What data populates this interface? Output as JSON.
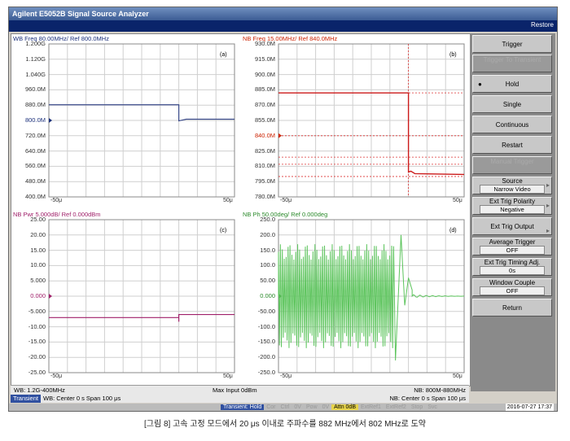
{
  "window": {
    "title": "Agilent E5052B Signal Source Analyzer",
    "restore_label": "Restore"
  },
  "panels": {
    "a": {
      "title": "WB Freq 80.00MHz/ Ref 800.0MHz",
      "badge": "(a)",
      "title_color": "#1a2f7a",
      "y_labels": [
        "1.200G",
        "1.120G",
        "1.040G",
        "960.0M",
        "880.0M",
        "800.0M",
        "720.0M",
        "640.0M",
        "560.0M",
        "480.0M",
        "400.0M"
      ],
      "x_left": "-50μ",
      "x_right": "50μ",
      "ref_label": "800.0M"
    },
    "b": {
      "title": "NB Freq 15.00MHz/ Ref 840.0MHz",
      "badge": "(b)",
      "title_color": "#cc2200",
      "y_labels": [
        "930.0M",
        "915.0M",
        "900.0M",
        "885.0M",
        "870.0M",
        "855.0M",
        "840.0M",
        "825.0M",
        "810.0M",
        "795.0M",
        "780.0M"
      ],
      "x_left": "-50μ",
      "x_right": "50μ",
      "ref_label": "840.0M"
    },
    "c": {
      "title": "NB Pwr 5.000dB/ Ref 0.000dBm",
      "badge": "(c)",
      "title_color": "#a0206a",
      "y_labels": [
        "25.00",
        "20.00",
        "15.00",
        "10.00",
        "5.000",
        "0.000",
        "-5.000",
        "-10.00",
        "-15.00",
        "-20.00",
        "-25.00"
      ],
      "x_left": "-50μ",
      "x_right": "50μ",
      "ref_label": "0.000"
    },
    "d": {
      "title": "NB Ph 50.00deg/ Ref 0.000deg",
      "badge": "(d)",
      "title_color": "#2a8a2a",
      "y_labels": [
        "250.0",
        "200.0",
        "150.0",
        "100.0",
        "50.00",
        "0.000",
        "-50.00",
        "-100.0",
        "-150.0",
        "-200.0",
        "-250.0"
      ],
      "x_left": "-50μ",
      "x_right": "50μ",
      "ref_label": "0.000"
    }
  },
  "status": {
    "wb_range": "WB: 1.2G-400MHz",
    "max_input": "Max Input 0dBm",
    "nb_range": "NB: 800M-880MHz",
    "transient": "Transient",
    "wb_center": "WB: Center 0 s  Span 100 μs",
    "nb_center": "NB: Center 0 s  Span 100 μs"
  },
  "bottom": {
    "items": [
      "Transient: Hold",
      "Cor",
      "Ctrl",
      "0V",
      "Pow",
      "0V",
      "Attn 0dB",
      "ExtRef1",
      "ExtRef2",
      "Stop",
      "Svc"
    ],
    "datetime": "2016-07-27 17:37"
  },
  "softkeys": {
    "trigger": "Trigger",
    "trigger_to_transient": "Trigger To Transient",
    "hold": "Hold",
    "single": "Single",
    "continuous": "Continuous",
    "restart": "Restart",
    "manual_trigger": "Manual Trigger",
    "source": "Source",
    "source_val": "Narrow Video",
    "ext_trig_polarity": "Ext Trig Polarity",
    "ext_trig_polarity_val": "Negative",
    "ext_trig_output": "Ext Trig Output",
    "average_trigger": "Average Trigger",
    "average_trigger_val": "OFF",
    "ext_trig_timing": "Ext Trig Timing Adj.",
    "ext_trig_timing_val": "0s",
    "window_couple": "Window Couple",
    "window_couple_val": "OFF",
    "return": "Return"
  },
  "caption": "[그림 8] 고속 고정 모드에서 20 μs 이내로 주파수를 882 MHz에서 802 MHz로 도약",
  "traces": {
    "a_wideband_frequency_mhz": {
      "before": 882,
      "after": 802,
      "jump_time_us": 20
    },
    "b_narrowband_frequency_mhz": {
      "before": 882,
      "after": 802,
      "jump_time_us": 20
    },
    "c_power_dbm": {
      "before": -7,
      "after": -6,
      "jump_time_us": 20
    },
    "d_phase_deg": {
      "settled": 0
    }
  }
}
